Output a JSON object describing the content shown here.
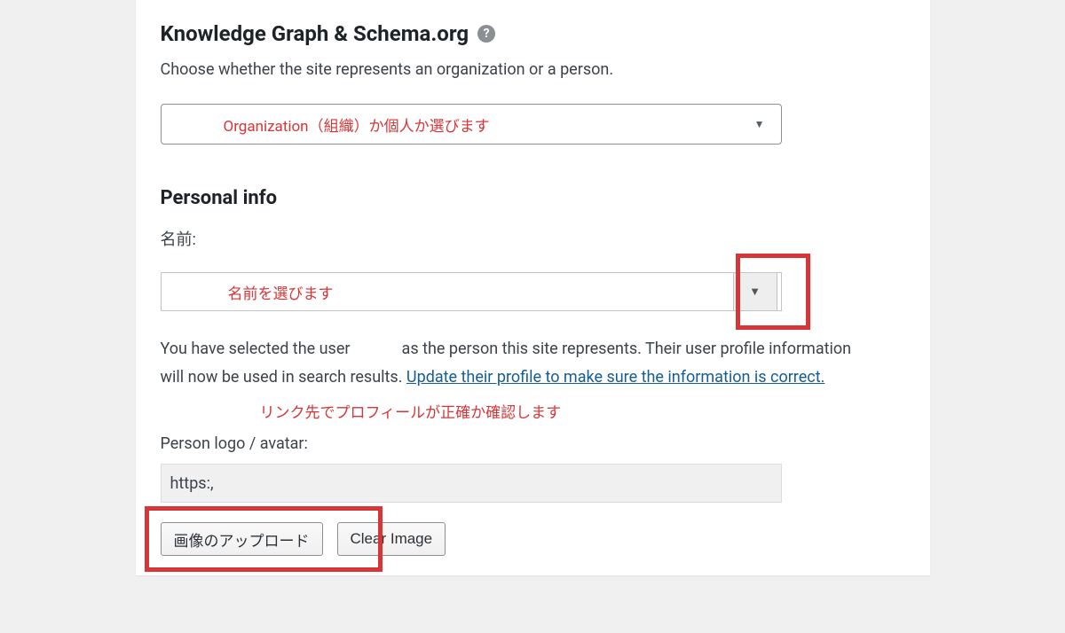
{
  "section": {
    "title": "Knowledge Graph & Schema.org",
    "description": "Choose whether the site represents an organization or a person."
  },
  "entity_select": {
    "annotation": "Organization（組織）か個人か選びます"
  },
  "personal_info": {
    "heading": "Personal info",
    "name_label": "名前:",
    "name_annotation": "名前を選びます",
    "info_text_1": "You have selected the user ",
    "info_text_2": " as the person this site represents. Their user profile information will now be used in search results. ",
    "info_link": "Update their profile to make sure the information is correct.",
    "profile_hint": "リンク先でプロフィールが正確か確認します",
    "avatar_label": "Person logo / avatar:",
    "avatar_value": "https:,",
    "upload_button": "画像のアップロード",
    "clear_button": "Clear Image"
  }
}
